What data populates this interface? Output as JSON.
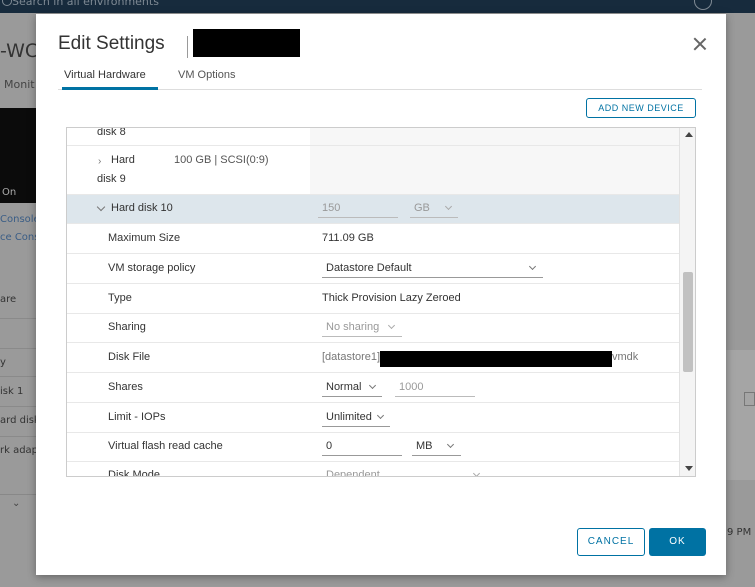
{
  "background": {
    "search_placeholder": "Search in all environments",
    "title_fragment": "-WC",
    "tab_fragment": "Monit",
    "power_state_fragment": "On",
    "console_link_1": "Console",
    "console_link_2": "ce Cons",
    "section_fragment": "are",
    "row_fragment_y": "y",
    "row_fragment_disk1": "isk 1",
    "row_fragment_harddisk": "ard disk",
    "row_fragment_netadapter": "rk adap",
    "time_fragment": "9 PM"
  },
  "modal": {
    "title": "Edit Settings",
    "tabs": [
      {
        "label": "Virtual Hardware",
        "active": true
      },
      {
        "label": "VM Options",
        "active": false
      }
    ],
    "add_device_label": "ADD NEW DEVICE",
    "cancel_label": "CANCEL",
    "ok_label": "OK"
  },
  "devices": {
    "hard_disk_8_tail": "disk 8",
    "hard_disk_9": {
      "label": "Hard",
      "label_tail": "disk 9",
      "summary": "100 GB | SCSI(0:9)"
    },
    "hard_disk_10": {
      "label": "Hard disk 10",
      "size_value": "150",
      "size_unit": "GB",
      "rows": {
        "max_size": {
          "label": "Maximum Size",
          "value": "711.09 GB"
        },
        "storage_policy": {
          "label": "VM storage policy",
          "value": "Datastore Default"
        },
        "type": {
          "label": "Type",
          "value": "Thick Provision Lazy Zeroed"
        },
        "sharing": {
          "label": "Sharing",
          "value": "No sharing"
        },
        "disk_file": {
          "label": "Disk File",
          "prefix": "[datastore1]",
          "suffix": "vmdk"
        },
        "shares": {
          "label": "Shares",
          "value": "Normal",
          "amount": "1000"
        },
        "limit_iops": {
          "label": "Limit - IOPs",
          "value": "Unlimited"
        },
        "flash_cache": {
          "label": "Virtual flash read cache",
          "value": "0",
          "unit": "MB"
        },
        "disk_mode": {
          "label": "Disk Mode",
          "value": "Dependent"
        }
      }
    }
  },
  "colors": {
    "accent": "#0072a3",
    "selected_row": "#dde6ec",
    "topbar": "#172b3d"
  }
}
